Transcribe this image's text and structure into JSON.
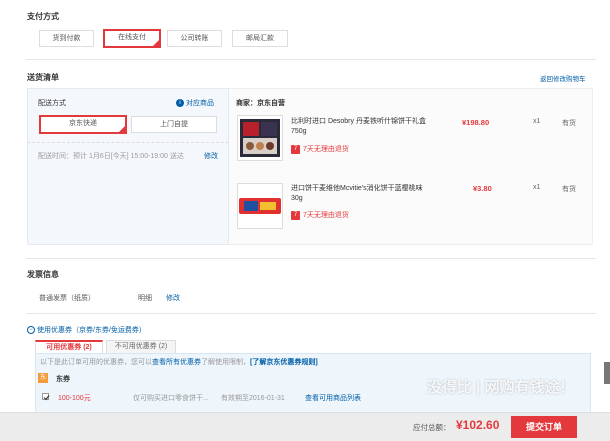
{
  "payment": {
    "title": "支付方式",
    "options": [
      "货到付款",
      "在线支付",
      "公司转账",
      "邮局汇款"
    ],
    "selected_index": 1
  },
  "delivery": {
    "title": "送货清单",
    "return_link": "返回修改购物车",
    "method_label": "配送方式",
    "supported_items_link": "对应商品",
    "methods": [
      "京东快递",
      "上门自提"
    ],
    "time_text": "配送时间：预计 1月6日[今天] 15:00-19:00 送达",
    "time_edit": "修改",
    "seller": "商家：京东自营",
    "items": [
      {
        "name": "比利时进口 Desobry 丹麦铁听什锦饼干礼盒 750g",
        "price": "¥198.80",
        "qty": "x1",
        "stock": "有货",
        "return_note": "7天无理由退货"
      },
      {
        "name": "进口饼干麦维他Mcvitie's消化饼干蓝樱桃味 30g",
        "price": "¥3.80",
        "qty": "x1",
        "stock": "有货",
        "return_note": "7天无理由退货"
      }
    ]
  },
  "invoice": {
    "title": "发票信息",
    "type": "普通发票（纸质）",
    "detail": "明细",
    "edit": "修改"
  },
  "coupon": {
    "toggle": "使用优惠券（京券/东券/免运费券）",
    "tab_usable_label": "可用优惠券",
    "tab_usable_count": "(2)",
    "tab_unusable": "不可用优惠券 (2)",
    "hint_prefix": "以下是此订单可用的优惠券，您可以",
    "hint_link1": "查看所有优惠券",
    "hint_mid": "了解使用限制，",
    "hint_link2": "[了解京东优惠券规则]",
    "group_icon": "东",
    "group_label": "东券",
    "row": {
      "amount": "100-100元",
      "desc": "仅可购买进口零食饼干...",
      "expiry": "有效期至2016-01-31",
      "link": "查看可用商品列表"
    }
  },
  "footer": {
    "total_label": "应付总额：",
    "total_value": "¥102.60",
    "submit": "提交订单",
    "watermark": "没得比 | 网购有钱途！"
  },
  "colors": {
    "accent": "#e4393c",
    "link": "#005ea7"
  }
}
